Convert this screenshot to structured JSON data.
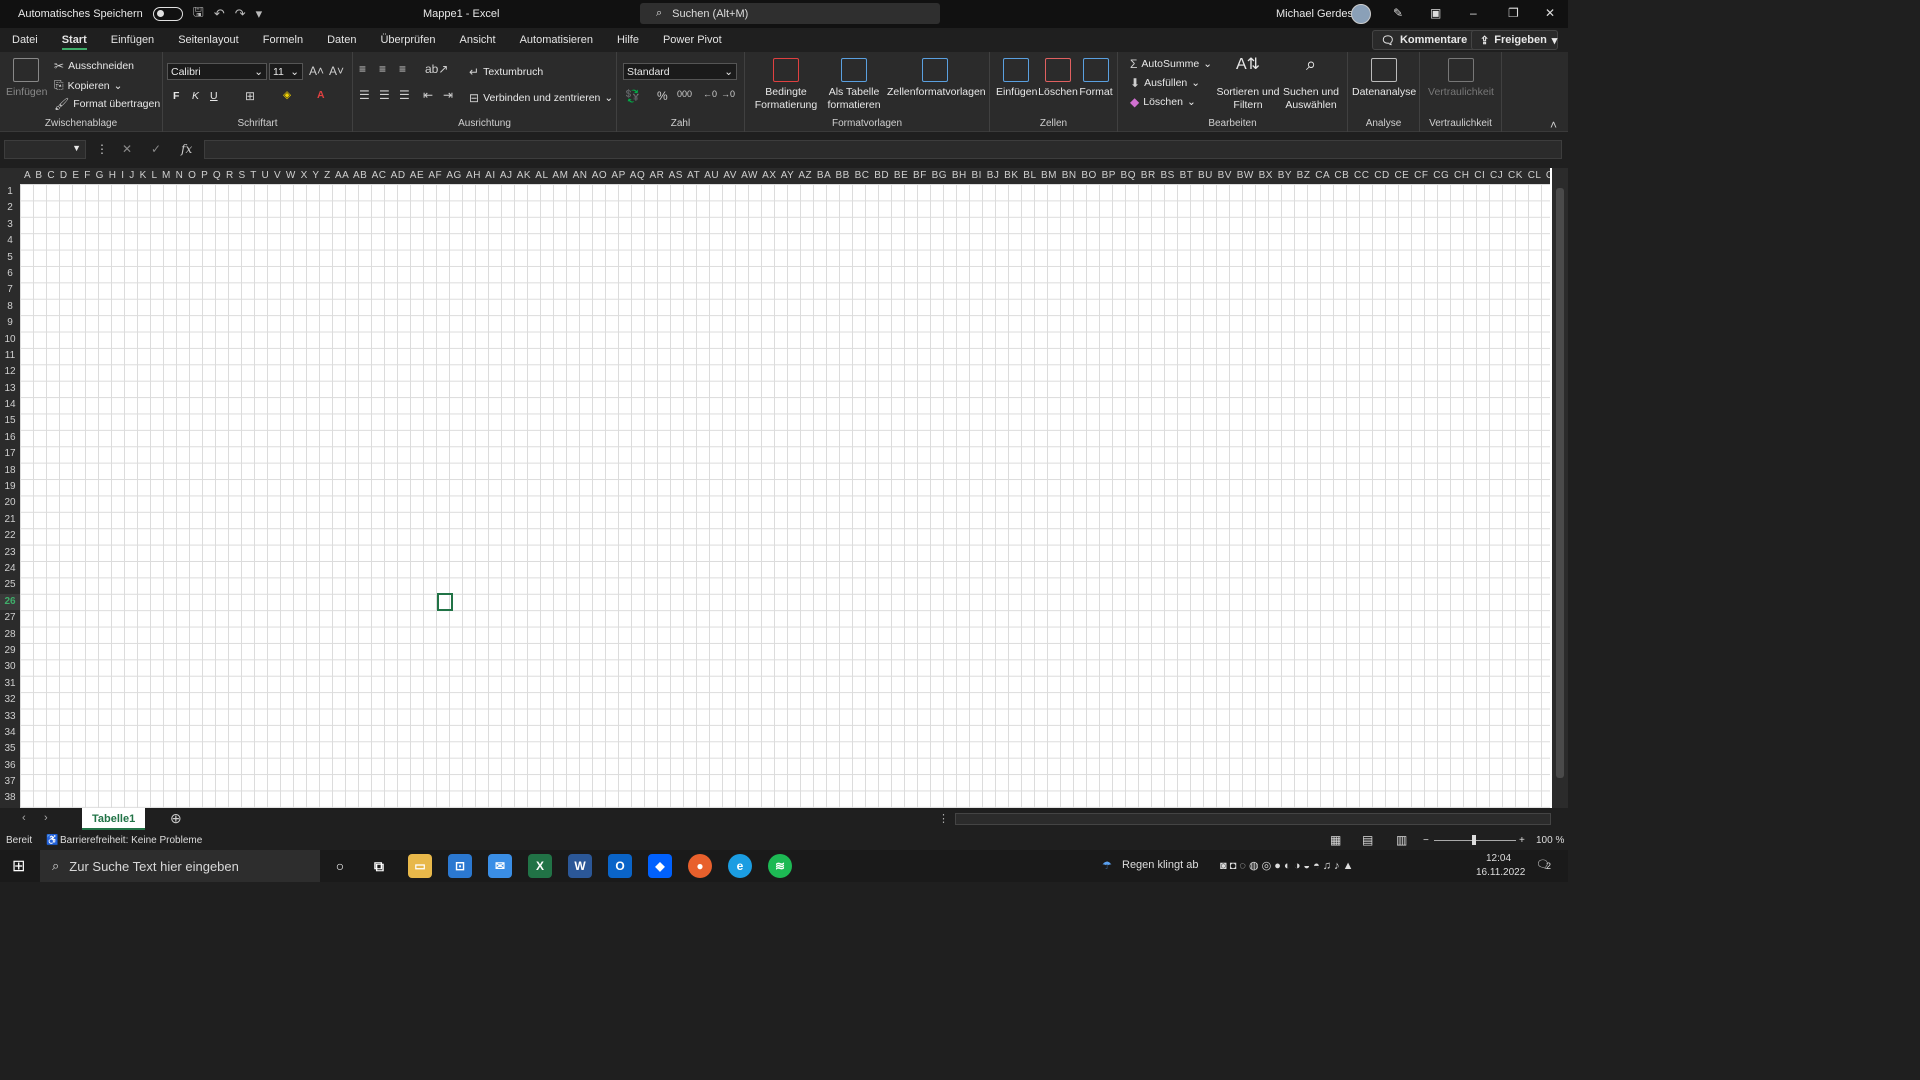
{
  "titlebar": {
    "autosave": "Automatisches Speichern",
    "doc": "Mappe1  -  Excel",
    "search": "Suchen (Alt+M)",
    "user": "Michael Gerdes"
  },
  "menu": {
    "tabs": [
      "Datei",
      "Start",
      "Einfügen",
      "Seitenlayout",
      "Formeln",
      "Daten",
      "Überprüfen",
      "Ansicht",
      "Automatisieren",
      "Hilfe",
      "Power Pivot"
    ],
    "comments": "Kommentare",
    "share": "Freigeben"
  },
  "ribbon": {
    "clipboard": {
      "paste": "Einfügen",
      "cut": "Ausschneiden",
      "copy": "Kopieren",
      "format_painter": "Format übertragen",
      "label": "Zwischenablage"
    },
    "font": {
      "name": "Calibri",
      "size": "11",
      "bold": "F",
      "italic": "K",
      "underline": "U",
      "label": "Schriftart"
    },
    "alignment": {
      "wrap": "Textumbruch",
      "merge": "Verbinden und zentrieren",
      "label": "Ausrichtung"
    },
    "number": {
      "format": "Standard",
      "label": "Zahl"
    },
    "styles": {
      "conditional": "Bedingte Formatierung",
      "table": "Als Tabelle formatieren",
      "cellstyles": "Zellenformatvorlagen",
      "label": "Formatvorlagen"
    },
    "cells": {
      "insert": "Einfügen",
      "delete": "Löschen",
      "format": "Format",
      "label": "Zellen"
    },
    "editing": {
      "autosum": "AutoSumme",
      "fill": "Ausfüllen",
      "clear": "Löschen",
      "sort": "Sortieren und Filtern",
      "find": "Suchen und Auswählen",
      "label": "Bearbeiten"
    },
    "analysis": {
      "data": "Datenanalyse",
      "label": "Analyse"
    },
    "sensitivity": {
      "btn": "Vertraulichkeit",
      "label": "Vertraulichkeit"
    }
  },
  "grid": {
    "columns": "A B C D E F G H I J K L M N O P Q R S T U V W X Y Z AA AB AC AD AE AF AG AH AI AJ AK AL AM AN AO AP AQ AR AS AT AU AV AW AX AY AZ BA BB BC BD BE BF BG BH BI BJ BK BL BM BN BO BP BQ BR BS BT BU BV BW BX BY BZ CA CB CC CD CE CF CG CH CI CJ CK CL CM CN CO CP CQ CR CS CT CU CV CW CX CY CZ DA DB DC DD DE DF DG DH DI DJ DK DL DM",
    "rows": 38,
    "selected_row": 26
  },
  "sheets": {
    "tab": "Tabelle1"
  },
  "status": {
    "ready": "Bereit",
    "accessibility": "Barrierefreiheit: Keine Probleme",
    "zoom": "100 %"
  },
  "taskbar": {
    "search": "Zur Suche Text hier eingeben",
    "weather": "Regen klingt ab",
    "time": "12:04",
    "date": "16.11.2022",
    "notif": "2"
  }
}
